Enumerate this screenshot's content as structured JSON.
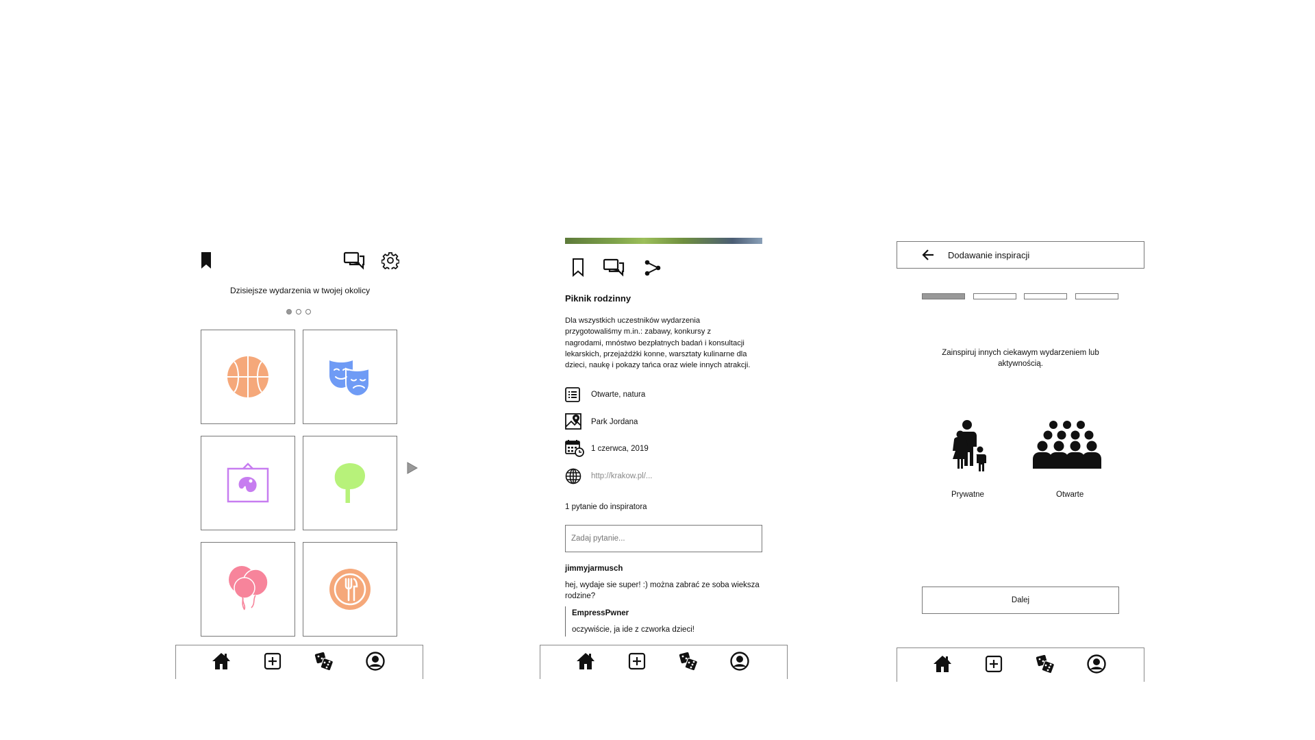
{
  "screen1": {
    "title": "Dzisiejsze wydarzenia w twojej okolicy",
    "carousel_dots": 3,
    "active_dot": 0,
    "tiles": [
      {
        "icon": "basketball-icon",
        "color": "#F5A87A"
      },
      {
        "icon": "theater-masks-icon",
        "color": "#6F9BF5"
      },
      {
        "icon": "painting-icon",
        "color": "#C77DF0"
      },
      {
        "icon": "tree-icon",
        "color": "#B7F27A"
      },
      {
        "icon": "balloons-icon",
        "color": "#F7849B"
      },
      {
        "icon": "plate-cutlery-icon",
        "color": "#F5A87A"
      }
    ]
  },
  "screen2": {
    "title": "Piknik rodzinny",
    "description": [
      "Dla wszystkich uczestników wydarzenia",
      "przygotowaliśmy m.in.: zabawy, konkursy z",
      "nagrodami, mnóstwo bezpłatnych badań i konsultacji",
      "lekarskich, przejażdżki konne, warsztaty kulinarne dla",
      "dzieci, naukę i pokazy tańca oraz wiele innych atrakcji."
    ],
    "category": "Otwarte, natura",
    "location": "Park Jordana",
    "date": "1 czerwca, 2019",
    "link": "http://krakow.pl/...",
    "questions_count": "1 pytanie do inspiratora",
    "question_placeholder": "Zadaj pytanie...",
    "comment": {
      "author": "jimmyjarmusch",
      "text_line1": "hej, wydaje sie super! :) można zabrać ze soba wieksza",
      "text_line2": "rodzine?",
      "reply_author": "EmpressPwner",
      "reply_text": "oczywiście, ja ide z czworka dzieci!"
    }
  },
  "screen3": {
    "header_title": "Dodawanie inspiracji",
    "steps_total": 4,
    "current_step": 1,
    "prompt_line1": "Zainspiruj innych ciekawym wydarzeniem lub",
    "prompt_line2": "aktywnością.",
    "option_private": "Prywatne",
    "option_open": "Otwarte",
    "next_label": "Dalej"
  },
  "colors": {
    "step_active": "#999999",
    "arrow_gray": "#999999"
  }
}
